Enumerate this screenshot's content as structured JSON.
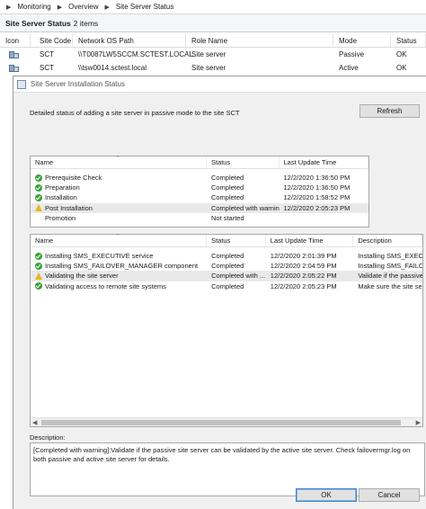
{
  "breadcrumb": {
    "items": [
      "Monitoring",
      "Overview",
      "Site Server Status"
    ]
  },
  "header": {
    "title": "Site Server Status",
    "count": "2 items"
  },
  "server_grid": {
    "columns": [
      "Icon",
      "Site Code",
      "Network OS Path",
      "Role Name",
      "Mode",
      "Status"
    ],
    "rows": [
      {
        "site_code": "SCT",
        "path": "\\\\T0087LW5SCCM.SCTEST.LOCAL",
        "role": "Site server",
        "mode": "Passive",
        "status": "OK"
      },
      {
        "site_code": "SCT",
        "path": "\\\\tsw0014.sctest.local",
        "role": "Site server",
        "mode": "Active",
        "status": "OK"
      }
    ]
  },
  "dialog": {
    "title": "Site Server Installation Status",
    "status_text": "Detailed status of adding a site server in passive mode to the site SCT",
    "refresh_label": "Refresh",
    "steps": {
      "columns": [
        "Name",
        "Status",
        "Last Update Time"
      ],
      "rows": [
        {
          "icon": "ok-icon",
          "name": "Prerequisite Check",
          "status": "Completed",
          "time": "12/2/2020 1:36:50 PM"
        },
        {
          "icon": "ok-icon",
          "name": "Preparation",
          "status": "Completed",
          "time": "12/2/2020 1:36:50 PM"
        },
        {
          "icon": "ok-icon",
          "name": "Installation",
          "status": "Completed",
          "time": "12/2/2020 1:58:52 PM"
        },
        {
          "icon": "warning-icon",
          "name": "Post Installation",
          "status": "Completed with warning",
          "time": "12/2/2020 2:05:23 PM"
        },
        {
          "icon": "none",
          "name": "Promotion",
          "status": "Not started",
          "time": ""
        }
      ]
    },
    "details": {
      "columns": [
        "Name",
        "Status",
        "Last Update Time",
        "Description"
      ],
      "rows": [
        {
          "icon": "ok-icon",
          "name": "Installing SMS_EXECUTIVE service",
          "status": "Completed",
          "time": "12/2/2020 2:01:39 PM",
          "desc": "Installing SMS_EXECI"
        },
        {
          "icon": "ok-icon",
          "name": "Installing SMS_FAILOVER_MANAGER component",
          "status": "Completed",
          "time": "12/2/2020 2:04:59 PM",
          "desc": "Installing SMS_FAILO"
        },
        {
          "icon": "warning-icon",
          "name": "Validating the site server",
          "status": "Completed with ...",
          "time": "12/2/2020 2:05:22 PM",
          "desc": "Validate if the passive"
        },
        {
          "icon": "ok-icon",
          "name": "Validating access to remote site systems",
          "status": "Completed",
          "time": "12/2/2020 2:05:23 PM",
          "desc": "Make sure the site se"
        }
      ]
    },
    "description_label": "Description:",
    "description_text": "[Completed with warning]:Validate if the passive site server can be validated by the active site server. Check failovermgr.log on both passive and active site server for details.",
    "ok_label": "OK",
    "cancel_label": "Cancel"
  }
}
